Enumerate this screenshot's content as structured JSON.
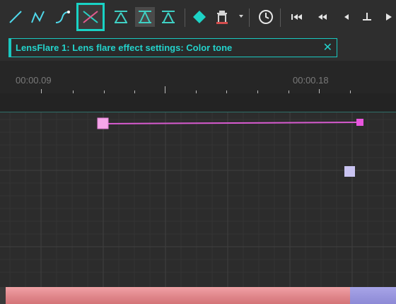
{
  "toolbar": {
    "icons": [
      "linear-curve-icon",
      "bezier-curve-icon",
      "smooth-curve-icon",
      "cross-curve-icon",
      "align-up-icon",
      "align-middle-icon",
      "align-down-icon",
      "add-keyframe-icon",
      "delete-keyframe-icon",
      "clock-icon",
      "skip-to-start-icon",
      "rewind-icon",
      "previous-frame-icon",
      "next-keyframe-icon",
      "play-icon"
    ]
  },
  "tab": {
    "label": "LensFlare 1: Lens flare effect settings: Color tone",
    "close_glyph": "✕"
  },
  "ruler": {
    "labels": [
      "00:00.09",
      "00:00.18"
    ]
  },
  "graph": {
    "keyframe_colors": {
      "pink": "#f29be0",
      "line": "#d85bd0",
      "lavender": "#c9c3f1"
    }
  },
  "colors": {
    "accent": "#19d3c5",
    "scroll_pink": "#e78a90",
    "scroll_lavender": "#9b98de"
  }
}
